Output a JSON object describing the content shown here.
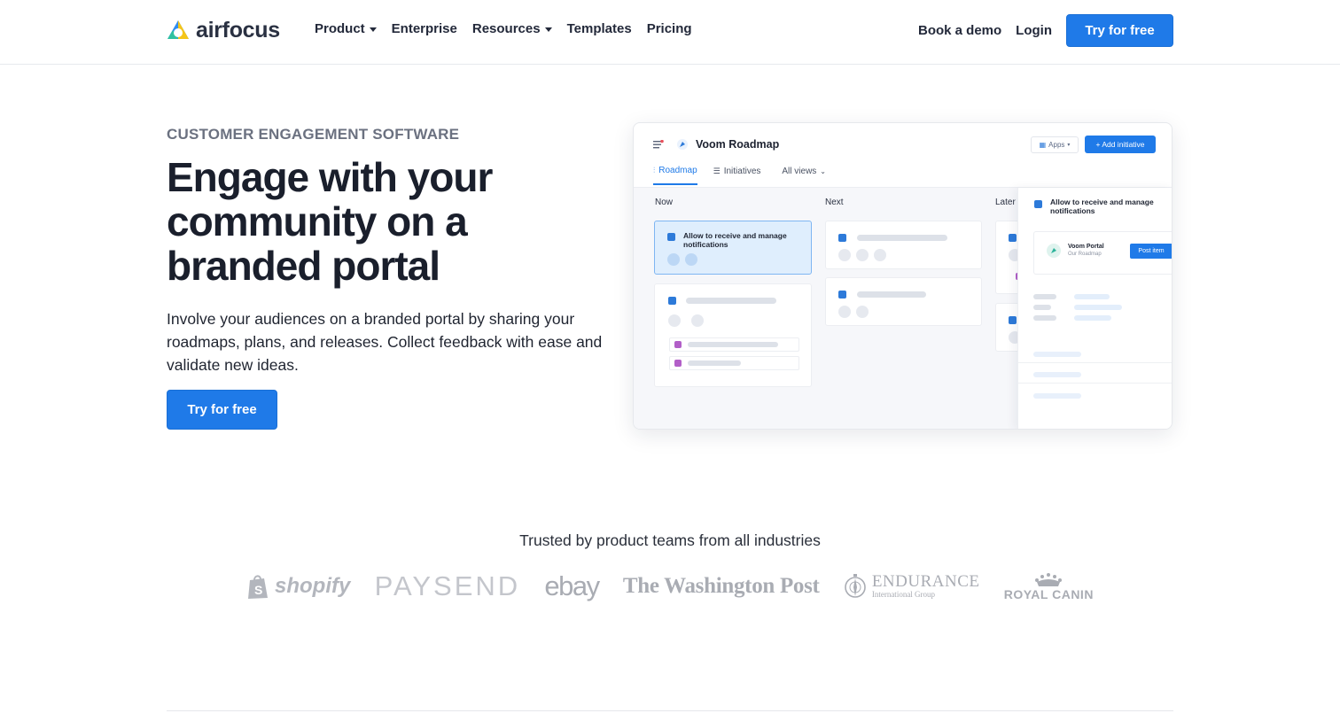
{
  "brand": {
    "name": "airfocus"
  },
  "nav": {
    "items": [
      {
        "label": "Product",
        "dropdown": true
      },
      {
        "label": "Enterprise",
        "dropdown": false
      },
      {
        "label": "Resources",
        "dropdown": true
      },
      {
        "label": "Templates",
        "dropdown": false
      },
      {
        "label": "Pricing",
        "dropdown": false
      }
    ],
    "book_demo": "Book a demo",
    "login": "Login",
    "cta": "Try for free"
  },
  "hero": {
    "eyebrow": "CUSTOMER ENGAGEMENT SOFTWARE",
    "headline": "Engage with your community on a branded portal",
    "subtext": "Involve your audiences on a branded portal by sharing your roadmaps, plans, and releases. Collect feedback with ease and validate new ideas.",
    "cta": "Try for free"
  },
  "mockup": {
    "title": "Voom Roadmap",
    "apps_label": "Apps",
    "add_label": "+ Add initiative",
    "tabs": [
      "Roadmap",
      "Initiatives",
      "All views"
    ],
    "columns": [
      "Now",
      "Next",
      "Later"
    ],
    "selected_card": "Allow to receive and manage notifications",
    "panel": {
      "title": "Allow to receive and manage notifications",
      "portal_name": "Voom Portal",
      "portal_sub": "Our Roadmap",
      "post_button": "Post item"
    }
  },
  "trust": {
    "heading": "Trusted by product teams from all industries",
    "logos": [
      "shopify",
      "PAYSEND",
      "ebay",
      "The Washington Post",
      "ENDURANCE",
      "International Group",
      "ROYAL CANIN"
    ]
  },
  "colors": {
    "primary": "#1f7ae8",
    "text": "#1d2433",
    "muted": "#6b7180",
    "logo_gray": "#b3b6bd"
  }
}
